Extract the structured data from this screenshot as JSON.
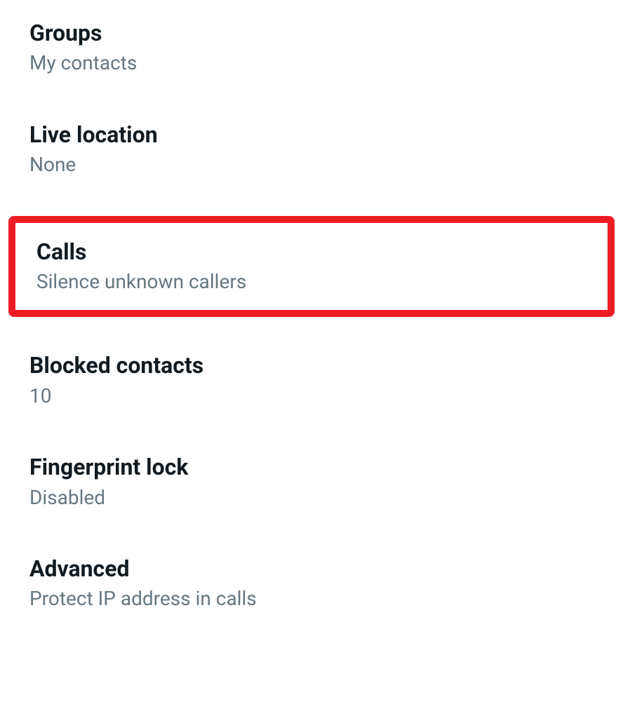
{
  "settings": {
    "items": [
      {
        "title": "Groups",
        "subtitle": "My contacts",
        "highlighted": false
      },
      {
        "title": "Live location",
        "subtitle": "None",
        "highlighted": false
      },
      {
        "title": "Calls",
        "subtitle": "Silence unknown callers",
        "highlighted": true
      },
      {
        "title": "Blocked contacts",
        "subtitle": "10",
        "highlighted": false
      },
      {
        "title": "Fingerprint lock",
        "subtitle": "Disabled",
        "highlighted": false
      },
      {
        "title": "Advanced",
        "subtitle": "Protect IP address in calls",
        "highlighted": false
      }
    ]
  },
  "colors": {
    "highlight_border": "#ed1c24",
    "title_text": "#111b21",
    "subtitle_text": "#667781"
  }
}
